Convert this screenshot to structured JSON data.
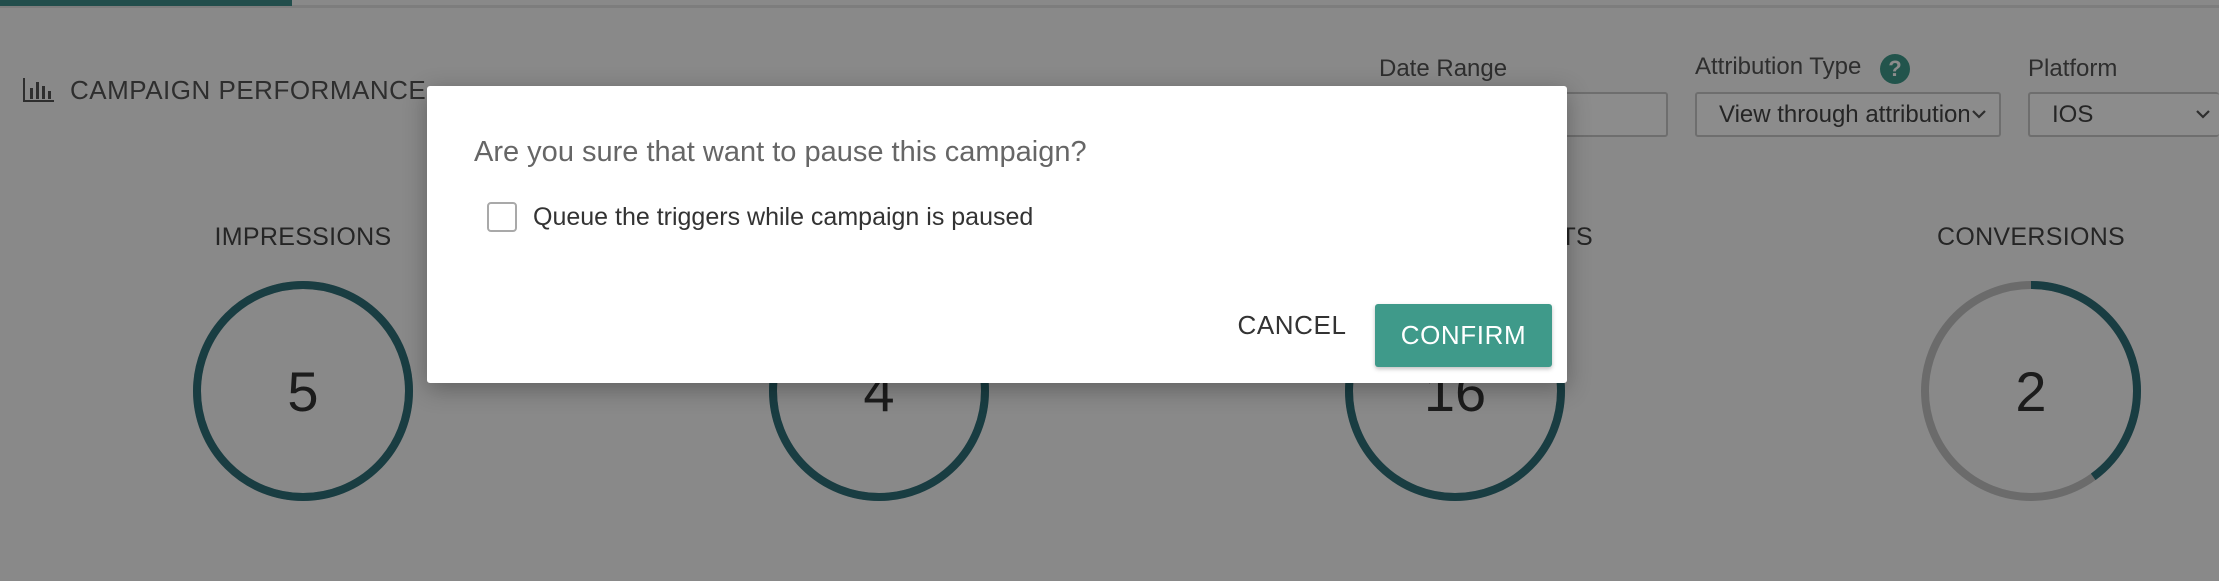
{
  "section": {
    "title": "CAMPAIGN PERFORMANCE",
    "icon": "bar-chart-icon"
  },
  "filters": {
    "date_range": {
      "label": "Date Range",
      "value": ""
    },
    "attribution_type": {
      "label": "Attribution Type",
      "value": "View through attribution",
      "help_icon": "?"
    },
    "platform": {
      "label": "Platform",
      "value": "IOS"
    }
  },
  "metrics": [
    {
      "label": "IMPRESSIONS",
      "value": "5",
      "fill": 1.0
    },
    {
      "label": "",
      "value": "4",
      "fill": 1.0
    },
    {
      "label": "TS",
      "value": "16",
      "fill": 1.0
    },
    {
      "label": "CONVERSIONS",
      "value": "2",
      "fill": 0.4
    }
  ],
  "modal": {
    "title": "Are you sure that want to pause this campaign?",
    "checkbox_label": "Queue the triggers while campaign is paused",
    "checkbox_checked": false,
    "cancel_label": "CANCEL",
    "confirm_label": "CONFIRM"
  },
  "colors": {
    "accent": "#3f9a8a",
    "ring": "#2f6f79",
    "ring_track": "#c4c4c4"
  }
}
